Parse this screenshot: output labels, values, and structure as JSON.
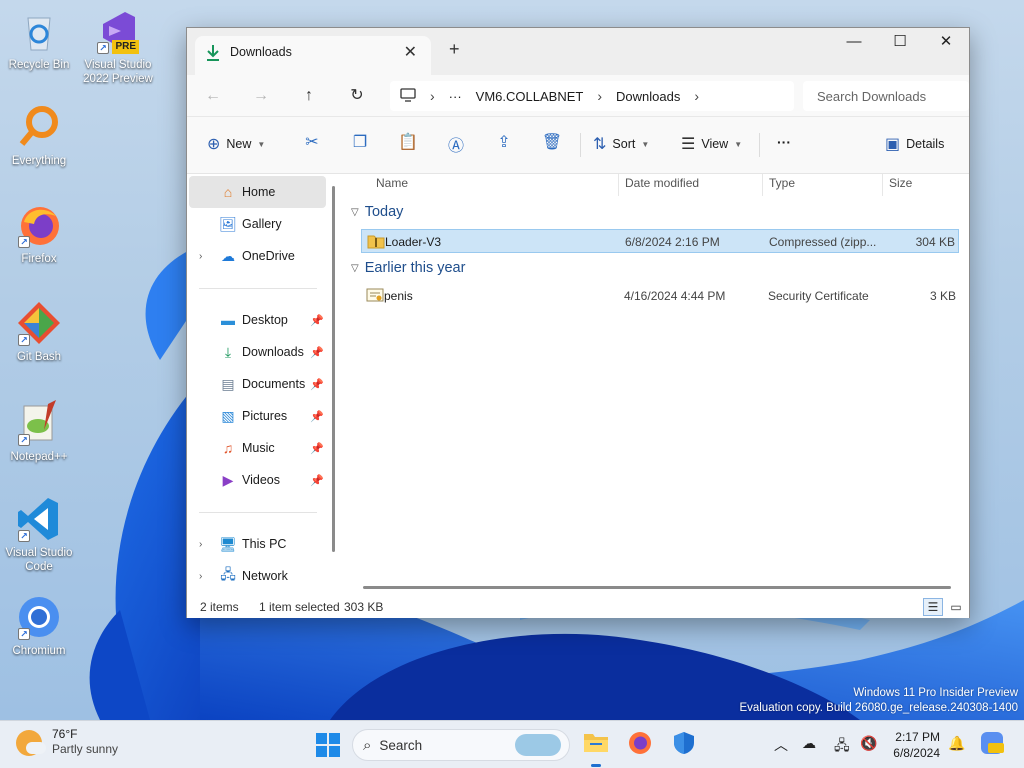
{
  "desktop": {
    "icons": [
      {
        "label": "Recycle Bin"
      },
      {
        "label": "Visual Studio 2022 Preview",
        "badge": "PRE"
      },
      {
        "label": "Everything"
      },
      {
        "label": "Firefox"
      },
      {
        "label": "Git Bash"
      },
      {
        "label": "Notepad++"
      },
      {
        "label": "Visual Studio Code"
      },
      {
        "label": "Chromium"
      }
    ],
    "watermark": {
      "line1": "Windows 11 Pro Insider Preview",
      "line2": "Evaluation copy. Build 26080.ge_release.240308-1400"
    }
  },
  "window": {
    "tab_title": "Downloads",
    "tab_close": "✕",
    "new_tab": "+",
    "controls": {
      "minimize": "—",
      "maximize": "☐",
      "close": "✕"
    },
    "address": {
      "crumbs": [
        "VM6.COLLABNET",
        "Downloads"
      ],
      "ellipsis": "···",
      "search_placeholder": "Search Downloads"
    },
    "toolbar": {
      "new_label": "New",
      "sort_label": "Sort",
      "view_label": "View",
      "more_label": "···",
      "details_label": "Details"
    },
    "nav": {
      "top": [
        {
          "label": "Home",
          "selected": true
        },
        {
          "label": "Gallery"
        },
        {
          "label": "OneDrive"
        }
      ],
      "quick": [
        {
          "label": "Desktop"
        },
        {
          "label": "Downloads"
        },
        {
          "label": "Documents"
        },
        {
          "label": "Pictures"
        },
        {
          "label": "Music"
        },
        {
          "label": "Videos"
        }
      ],
      "bottom": [
        {
          "label": "This PC"
        },
        {
          "label": "Network"
        }
      ]
    },
    "columns": [
      "Name",
      "Date modified",
      "Type",
      "Size"
    ],
    "groups": [
      {
        "title": "Today",
        "files": [
          {
            "name": "Loader-V3",
            "date": "6/8/2024 2:16 PM",
            "type": "Compressed (zipp...",
            "size": "304 KB",
            "selected": true
          }
        ]
      },
      {
        "title": "Earlier this year",
        "files": [
          {
            "name": "penis",
            "date": "4/16/2024 4:44 PM",
            "type": "Security Certificate",
            "size": "3 KB",
            "selected": false
          }
        ]
      }
    ],
    "status": {
      "count": "2 items",
      "selection": "1 item selected",
      "selection_size": "303 KB"
    }
  },
  "taskbar": {
    "weather": {
      "temp": "76°F",
      "condition": "Partly sunny"
    },
    "search_label": "Search",
    "clock": {
      "time": "2:17 PM",
      "date": "6/8/2024"
    }
  }
}
